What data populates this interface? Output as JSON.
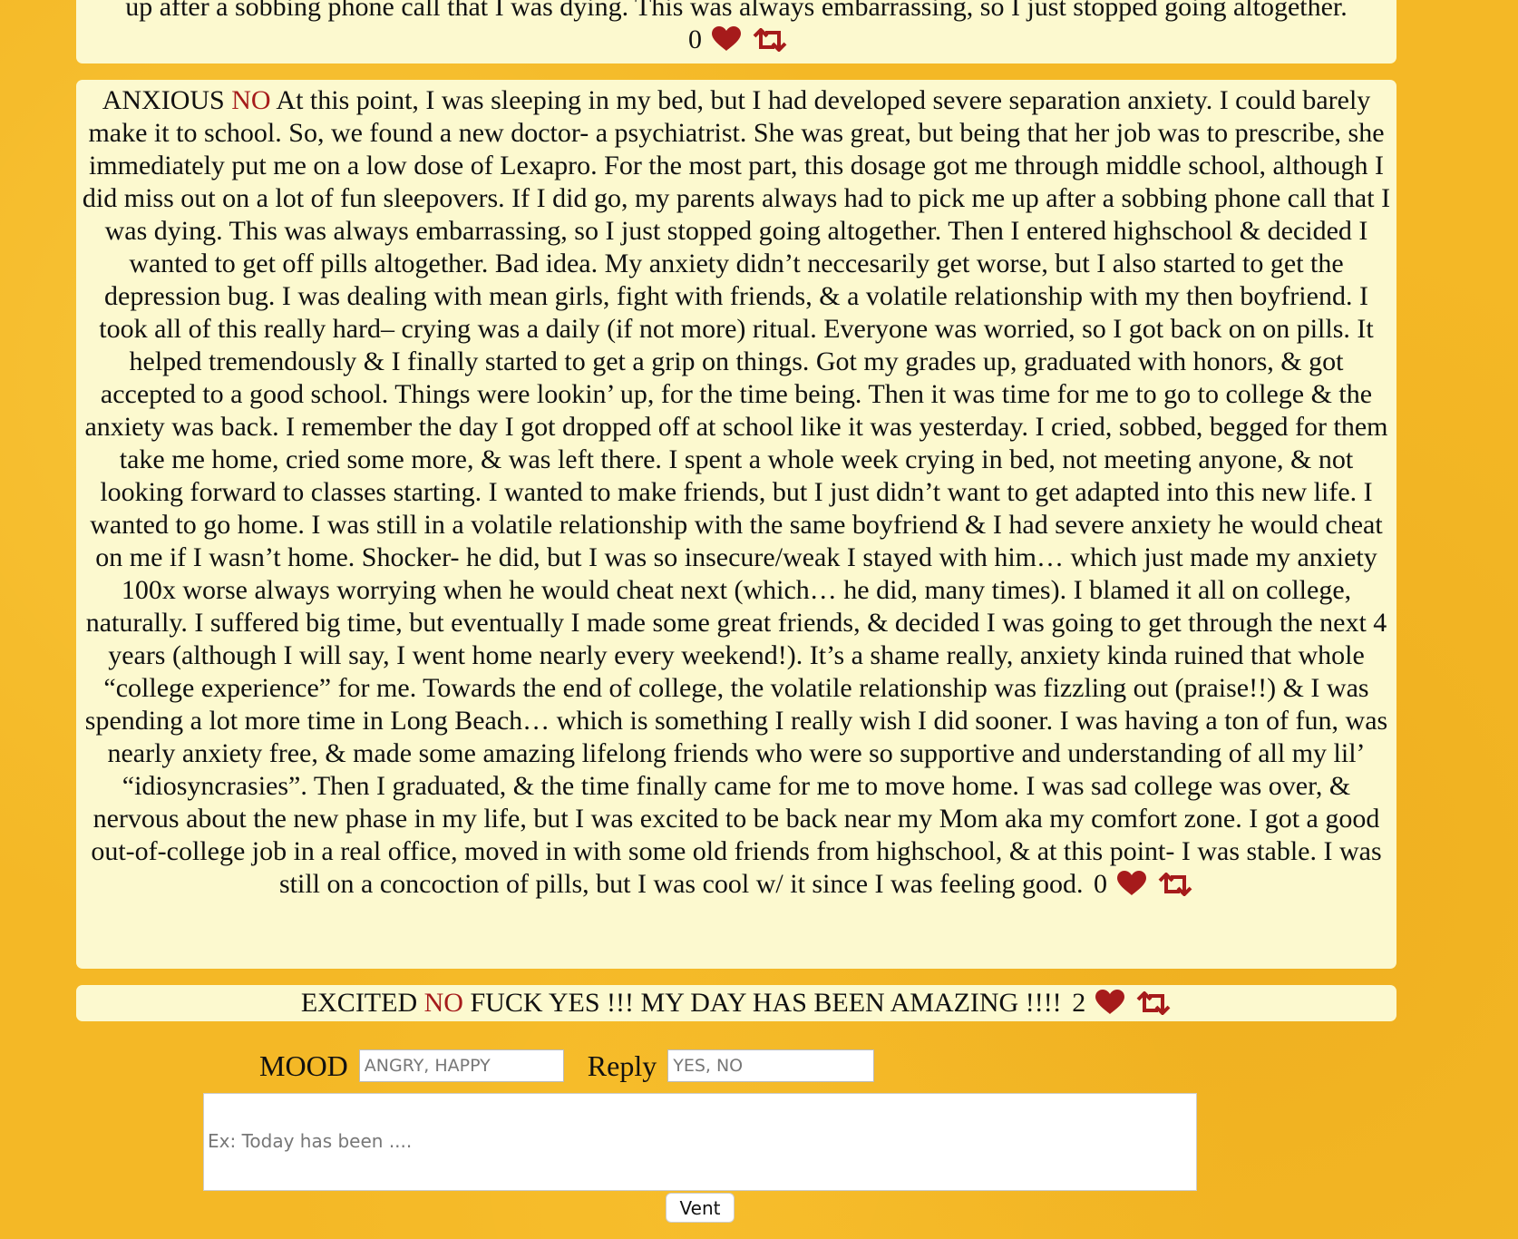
{
  "colors": {
    "background": "#f4b826",
    "post_background": "#fcf9cf",
    "reply_accent": "#a61b1b",
    "icon_color": "#a61b1b"
  },
  "icons": {
    "like": "heart-icon",
    "share": "retweet-icon"
  },
  "posts": [
    {
      "mood": "",
      "reply": "",
      "text": "up after a sobbing phone call that I was dying. This was always embarrassing, so I just stopped going altogether.",
      "likes": "0"
    },
    {
      "mood": "ANXIOUS",
      "reply": "NO",
      "text": "At this point, I was sleeping in my bed, but I had developed severe separation anxiety. I could barely make it to school. So, we found a new doctor- a psychiatrist. She was great, but being that her job was to prescribe, she immediately put me on a low dose of Lexapro. For the most part, this dosage got me through middle school, although I did miss out on a lot of fun sleepovers. If I did go, my parents always had to pick me up after a sobbing phone call that I was dying. This was always embarrassing, so I just stopped going altogether. Then I entered highschool & decided I wanted to get off pills altogether. Bad idea. My anxiety didn’t neccesarily get worse, but I also started to get the depression bug. I was dealing with mean girls, fight with friends, & a volatile relationship with my then boyfriend. I took all of this really hard– crying was a daily (if not more) ritual. Everyone was worried, so I got back on on pills. It helped tremendously & I finally started to get a grip on things. Got my grades up, graduated with honors, & got accepted to a good school. Things were lookin’ up, for the time being. Then it was time for me to go to college & the anxiety was back. I remember the day I got dropped off at school like it was yesterday. I cried, sobbed, begged for them take me home, cried some more, & was left there. I spent a whole week crying in bed, not meeting anyone, & not looking forward to classes starting. I wanted to make friends, but I just didn’t want to get adapted into this new life. I wanted to go home. I was still in a volatile relationship with the same boyfriend & I had severe anxiety he would cheat on me if I wasn’t home. Shocker- he did, but I was so insecure/weak I stayed with him… which just made my anxiety 100x worse always worrying when he would cheat next (which… he did, many times). I blamed it all on college, naturally. I suffered big time, but eventually I made some great friends, & decided I was going to get through the next 4 years (although I will say, I went home nearly every weekend!). It’s a shame really, anxiety kinda ruined that whole “college experience” for me. Towards the end of college, the volatile relationship was fizzling out (praise!!) & I was spending a lot more time in Long Beach… which is something I really wish I did sooner. I was having a ton of fun, was nearly anxiety free, & made some amazing lifelong friends who were so supportive and understanding of all my lil’ “idiosyncrasies”. Then I graduated, & the time finally came for me to move home. I was sad college was over, & nervous about the new phase in my life, but I was excited to be back near my Mom aka my comfort zone. I got a good out-of-college job in a real office, moved in with some old friends from highschool, & at this point- I was stable. I was still on a concoction of pills, but I was cool w/ it since I was feeling good.",
      "likes": "0"
    },
    {
      "mood": "EXCITED",
      "reply": "NO",
      "text": "FUCK YES !!! MY DAY HAS BEEN AMAZING !!!!",
      "likes": "2"
    }
  ],
  "form": {
    "mood_label": "MOOD",
    "mood_placeholder": "ANGRY, HAPPY",
    "reply_label": "Reply",
    "reply_placeholder": "YES, NO",
    "vent_placeholder": "Ex: Today has been ....",
    "submit_label": "Vent"
  }
}
